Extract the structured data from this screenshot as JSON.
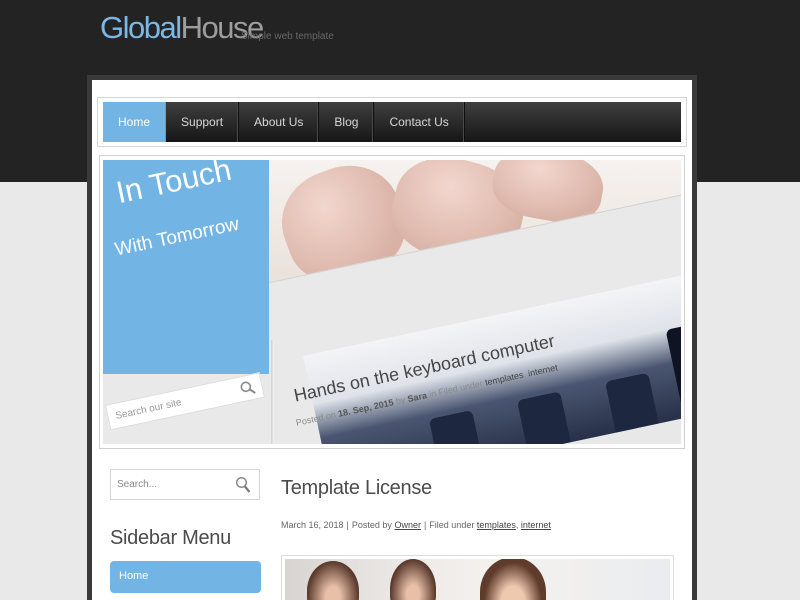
{
  "brand": {
    "name_part1": "Global",
    "name_part2": "House",
    "tagline": "Simple web template"
  },
  "nav": {
    "items": [
      {
        "label": "Home",
        "active": true
      },
      {
        "label": "Support",
        "active": false
      },
      {
        "label": "About Us",
        "active": false
      },
      {
        "label": "Blog",
        "active": false
      },
      {
        "label": "Contact Us",
        "active": false
      }
    ]
  },
  "hero": {
    "heading": "In Touch",
    "subheading": "With Tomorrow",
    "post_title": "Hands on the keyboard computer",
    "post_meta": {
      "prefix": "Posted on",
      "date": "18. Sep, 2015",
      "by": "by",
      "author": "Sara",
      "filed": "in Filed under",
      "tag1": "templates",
      "tag2": "internet"
    },
    "search_placeholder": "Search our site"
  },
  "sidebar": {
    "search_placeholder": "Search...",
    "menu_title": "Sidebar Menu",
    "menu_items": [
      {
        "label": "Home"
      }
    ]
  },
  "post": {
    "title": "Template License",
    "date": "March 16, 2018",
    "posted_by_label": "Posted by",
    "author": "Owner",
    "filed_label": "Filed under",
    "tag1": "templates",
    "tag2": "internet"
  },
  "colors": {
    "accent": "#72b4e4",
    "header_bg": "#232323",
    "page_bg": "#e9e9e9"
  }
}
